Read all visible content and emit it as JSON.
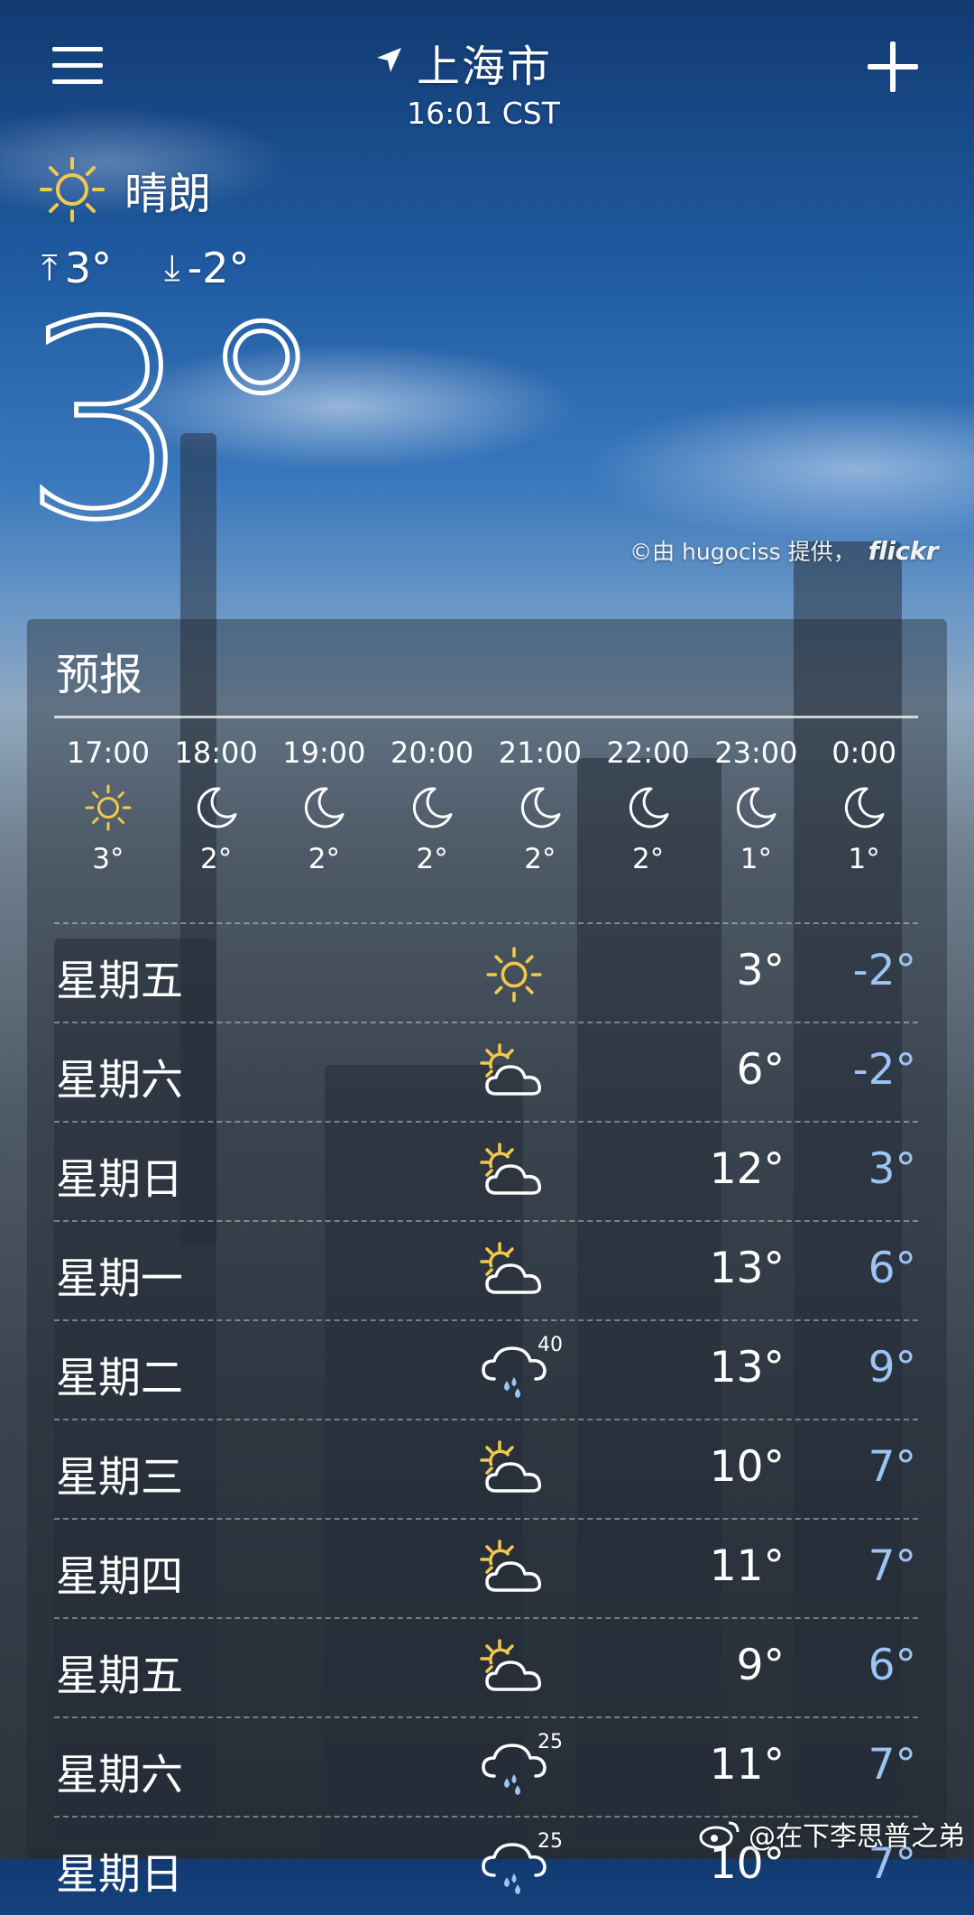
{
  "header": {
    "city": "上海市",
    "time": "16:01 CST"
  },
  "current": {
    "condition": "晴朗",
    "icon": "sun-icon",
    "high": "3°",
    "low": "-2°",
    "temp": "3°"
  },
  "credit": {
    "text": "©由 hugociss 提供，",
    "brand": "flickr"
  },
  "forecast": {
    "title": "预报",
    "hourly": [
      {
        "time": "17:00",
        "icon": "sun-icon",
        "temp": "3°"
      },
      {
        "time": "18:00",
        "icon": "moon-icon",
        "temp": "2°"
      },
      {
        "time": "19:00",
        "icon": "moon-icon",
        "temp": "2°"
      },
      {
        "time": "20:00",
        "icon": "moon-icon",
        "temp": "2°"
      },
      {
        "time": "21:00",
        "icon": "moon-icon",
        "temp": "2°"
      },
      {
        "time": "22:00",
        "icon": "moon-icon",
        "temp": "2°"
      },
      {
        "time": "23:00",
        "icon": "moon-icon",
        "temp": "1°"
      },
      {
        "time": "0:00",
        "icon": "moon-icon",
        "temp": "1°"
      }
    ],
    "daily": [
      {
        "day": "星期五",
        "icon": "sun-icon",
        "precip": "",
        "high": "3°",
        "low": "-2°"
      },
      {
        "day": "星期六",
        "icon": "partly-cloudy-icon",
        "precip": "",
        "high": "6°",
        "low": "-2°"
      },
      {
        "day": "星期日",
        "icon": "partly-cloudy-icon",
        "precip": "",
        "high": "12°",
        "low": "3°"
      },
      {
        "day": "星期一",
        "icon": "partly-cloudy-icon",
        "precip": "",
        "high": "13°",
        "low": "6°"
      },
      {
        "day": "星期二",
        "icon": "rain-icon",
        "precip": "40",
        "high": "13°",
        "low": "9°"
      },
      {
        "day": "星期三",
        "icon": "partly-cloudy-icon",
        "precip": "",
        "high": "10°",
        "low": "7°"
      },
      {
        "day": "星期四",
        "icon": "partly-cloudy-icon",
        "precip": "",
        "high": "11°",
        "low": "7°"
      },
      {
        "day": "星期五",
        "icon": "partly-cloudy-icon",
        "precip": "",
        "high": "9°",
        "low": "6°"
      },
      {
        "day": "星期六",
        "icon": "rain-icon",
        "precip": "25",
        "high": "11°",
        "low": "7°"
      },
      {
        "day": "星期日",
        "icon": "rain-icon",
        "precip": "25",
        "high": "10°",
        "low": "7°"
      }
    ]
  },
  "watermark": {
    "text": "@在下李思普之弟"
  },
  "colors": {
    "low_temp": "#9cc4f4",
    "sun": "#f2c94c"
  }
}
